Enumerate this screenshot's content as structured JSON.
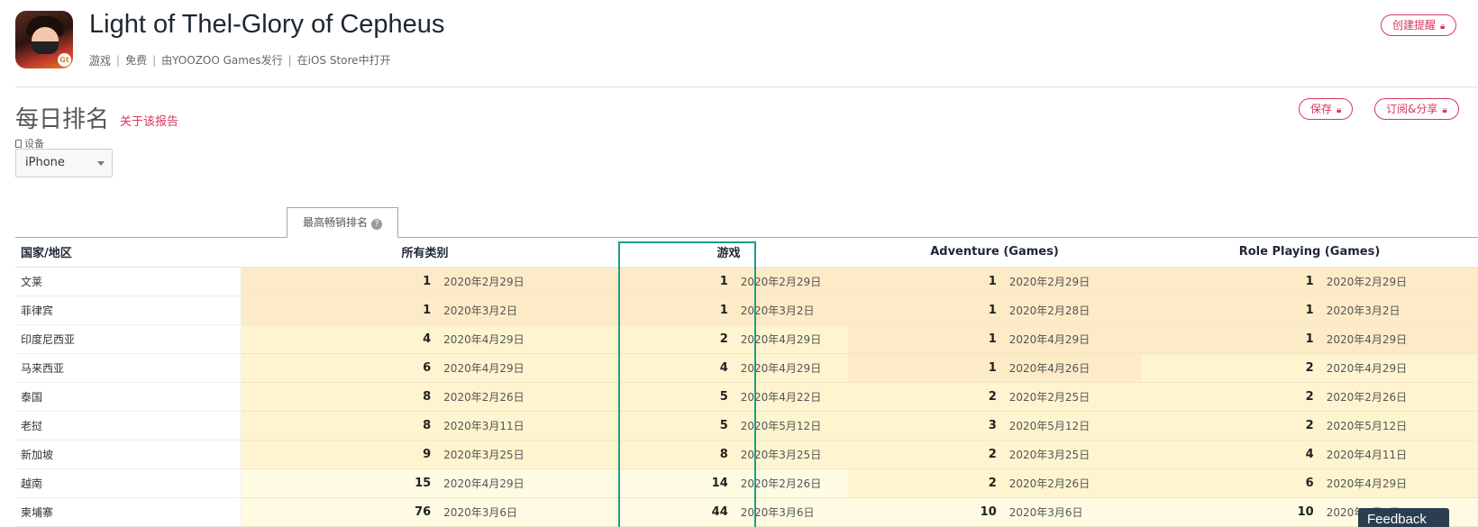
{
  "app": {
    "title": "Light of Thel-Glory of Cepheus",
    "meta": {
      "category": "游戏",
      "price": "免费",
      "publisher": "由YOOZOO Games发行",
      "store": "在iOS Store中打开"
    },
    "icon_badge": "Gt"
  },
  "buttons": {
    "create_alert": "创建提醒",
    "save": "保存",
    "subscribe_share": "订阅&分享"
  },
  "section": {
    "title": "每日排名",
    "report_link": "关于该报告"
  },
  "device": {
    "label": "设备",
    "selected": "iPhone"
  },
  "tab": {
    "label": "最高畅销排名",
    "help": "?"
  },
  "table": {
    "headers": [
      "国家/地区",
      "所有类别",
      "游戏",
      "Adventure (Games)",
      "Role Playing (Games)"
    ],
    "rows": [
      {
        "country": "文莱",
        "cells": [
          [
            "1",
            "2020年2月29日"
          ],
          [
            "1",
            "2020年2月29日"
          ],
          [
            "1",
            "2020年2月29日"
          ],
          [
            "1",
            "2020年2月29日"
          ]
        ]
      },
      {
        "country": "菲律宾",
        "cells": [
          [
            "1",
            "2020年3月2日"
          ],
          [
            "1",
            "2020年3月2日"
          ],
          [
            "1",
            "2020年2月28日"
          ],
          [
            "1",
            "2020年3月2日"
          ]
        ]
      },
      {
        "country": "印度尼西亚",
        "cells": [
          [
            "4",
            "2020年4月29日"
          ],
          [
            "2",
            "2020年4月29日"
          ],
          [
            "1",
            "2020年4月29日"
          ],
          [
            "1",
            "2020年4月29日"
          ]
        ]
      },
      {
        "country": "马来西亚",
        "cells": [
          [
            "6",
            "2020年4月29日"
          ],
          [
            "4",
            "2020年4月29日"
          ],
          [
            "1",
            "2020年4月26日"
          ],
          [
            "2",
            "2020年4月29日"
          ]
        ]
      },
      {
        "country": "泰国",
        "cells": [
          [
            "8",
            "2020年2月26日"
          ],
          [
            "5",
            "2020年4月22日"
          ],
          [
            "2",
            "2020年2月25日"
          ],
          [
            "2",
            "2020年2月26日"
          ]
        ]
      },
      {
        "country": "老挝",
        "cells": [
          [
            "8",
            "2020年3月11日"
          ],
          [
            "5",
            "2020年5月12日"
          ],
          [
            "3",
            "2020年5月12日"
          ],
          [
            "2",
            "2020年5月12日"
          ]
        ]
      },
      {
        "country": "新加坡",
        "cells": [
          [
            "9",
            "2020年3月25日"
          ],
          [
            "8",
            "2020年3月25日"
          ],
          [
            "2",
            "2020年3月25日"
          ],
          [
            "4",
            "2020年4月11日"
          ]
        ]
      },
      {
        "country": "越南",
        "cells": [
          [
            "15",
            "2020年4月29日"
          ],
          [
            "14",
            "2020年2月26日"
          ],
          [
            "2",
            "2020年2月26日"
          ],
          [
            "6",
            "2020年4月29日"
          ]
        ]
      },
      {
        "country": "柬埔寨",
        "cells": [
          [
            "76",
            "2020年3月6日"
          ],
          [
            "44",
            "2020年3月6日"
          ],
          [
            "10",
            "2020年3月6日"
          ],
          [
            "10",
            "2020年3月6日"
          ]
        ]
      }
    ]
  },
  "feedback": "Feedback",
  "colors": {
    "accent": "#d9365e",
    "highlight_box": "#1a9e86",
    "rank_top": "#fdebc7",
    "rank_mid": "#fef5d0",
    "rank_low": "#fefbe2"
  }
}
